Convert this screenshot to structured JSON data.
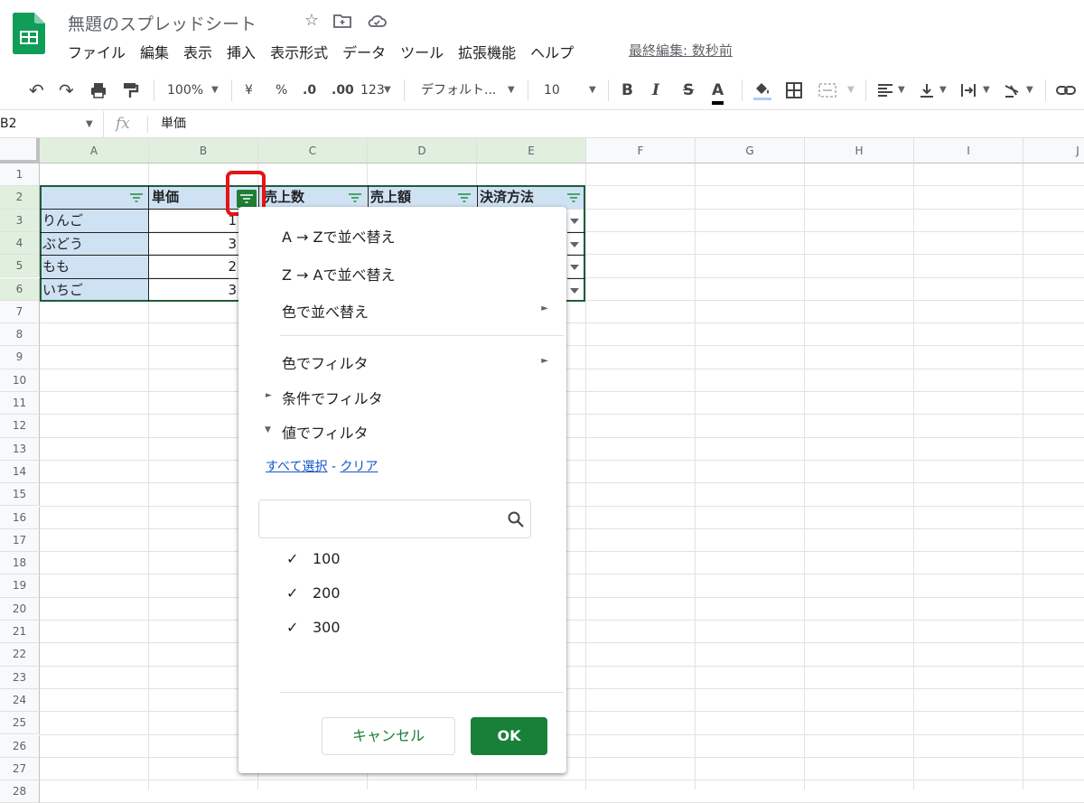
{
  "app": {
    "title": "無題のスプレッドシート",
    "last_edit": "最終編集: 数秒前"
  },
  "menus": [
    "ファイル",
    "編集",
    "表示",
    "挿入",
    "表示形式",
    "データ",
    "ツール",
    "拡張機能",
    "ヘルプ"
  ],
  "toolbar": {
    "zoom": "100%",
    "currency": "¥",
    "percent": "%",
    "decimal_dec": ".0",
    "decimal_inc": ".00",
    "format_more": "123",
    "font": "デフォルト...",
    "font_size": "10",
    "bold": "B",
    "italic": "I",
    "strike": "S",
    "textcolor": "A"
  },
  "formula_bar": {
    "cell_ref": "B2",
    "fx": "fx",
    "value": "単価"
  },
  "columns": [
    "A",
    "B",
    "C",
    "D",
    "E",
    "F",
    "G",
    "H",
    "I",
    "J"
  ],
  "rows": [
    "1",
    "2",
    "3",
    "4",
    "5",
    "6",
    "7",
    "8",
    "9",
    "10",
    "11",
    "12",
    "13",
    "14",
    "15",
    "16",
    "17",
    "18",
    "19",
    "20",
    "21",
    "22",
    "23",
    "24",
    "25",
    "26",
    "27",
    "28"
  ],
  "table": {
    "headers": [
      "",
      "単価",
      "売上数",
      "売上額",
      "決済方法"
    ],
    "col_a": [
      "りんご",
      "ぶどう",
      "もも",
      "いちご"
    ],
    "col_b": [
      "1",
      "3",
      "2",
      "3"
    ]
  },
  "filter_menu": {
    "sort_az": "A → Zで並べ替え",
    "sort_za": "Z → Aで並べ替え",
    "sort_color": "色で並べ替え",
    "filter_color": "色でフィルタ",
    "filter_condition": "条件でフィルタ",
    "filter_value": "値でフィルタ",
    "select_all": "すべて選択",
    "link_sep": "-",
    "clear": "クリア",
    "search_placeholder": "",
    "values": [
      "100",
      "200",
      "300"
    ],
    "cancel": "キャンセル",
    "ok": "OK"
  },
  "colors": {
    "accent_green": "#188038",
    "header_blue": "#cfe2f3",
    "highlight_red": "#e31515",
    "link": "#1155cc"
  }
}
